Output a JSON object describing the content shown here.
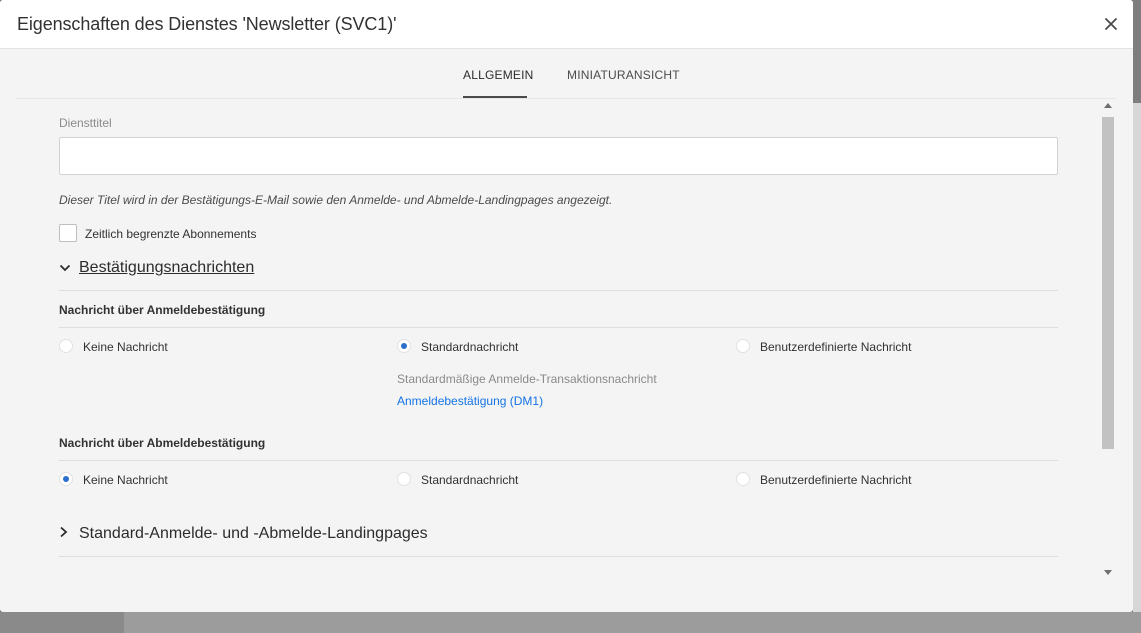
{
  "dialog": {
    "title": "Eigenschaften des Dienstes 'Newsletter (SVC1)'",
    "close_icon": "close-icon"
  },
  "tabs": [
    {
      "label": "ALLGEMEIN",
      "active": true
    },
    {
      "label": "MINIATURANSICHT",
      "active": false
    }
  ],
  "general": {
    "service_title_label": "Diensttitel",
    "service_title_value": "",
    "service_title_hint": "Dieser Titel wird in der Bestätigungs-E-Mail sowie den Anmelde- und Abmelde-Landingpages angezeigt.",
    "limited_subscriptions_label": "Zeitlich begrenzte Abonnements",
    "limited_subscriptions_checked": false
  },
  "confirmation_section": {
    "title": "Bestätigungsnachrichten",
    "expanded": true,
    "subscribe": {
      "heading": "Nachricht über Anmeldebestätigung",
      "options": [
        "Keine Nachricht",
        "Standardnachricht",
        "Benutzerdefinierte Nachricht"
      ],
      "selected": "Standardnachricht",
      "default_info": "Standardmäßige Anmelde-Transaktionsnachricht",
      "default_link": "Anmeldebestätigung (DM1)"
    },
    "unsubscribe": {
      "heading": "Nachricht über Abmeldebestätigung",
      "options": [
        "Keine Nachricht",
        "Standardnachricht",
        "Benutzerdefinierte Nachricht"
      ],
      "selected": "Keine Nachricht"
    }
  },
  "landing_section": {
    "title": "Standard-Anmelde- und -Abmelde-Landingpages",
    "expanded": false
  },
  "colors": {
    "accent": "#2c6ecb",
    "link": "#1473e6"
  }
}
